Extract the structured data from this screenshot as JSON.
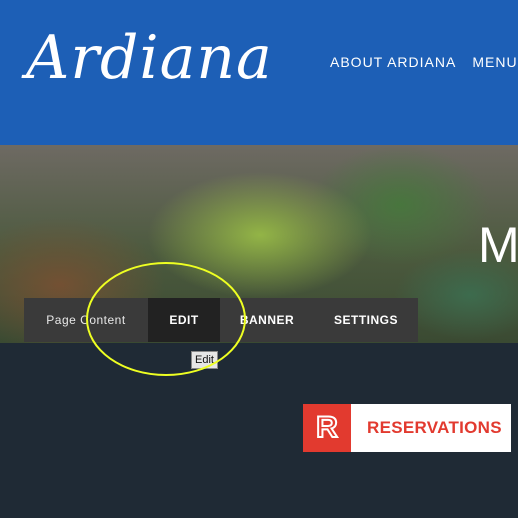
{
  "header": {
    "logo_text": "Ardiana",
    "nav": [
      "ABOUT ARDIANA",
      "MENU"
    ]
  },
  "hero": {
    "partial_heading": "M"
  },
  "editor_toolbar": {
    "section_label": "Page Content",
    "edit": "EDIT",
    "banner": "BANNER",
    "settings": "SETTINGS",
    "tooltip": "Edit"
  },
  "reservations": {
    "icon_letter": "R",
    "label": "RESERVATIONS"
  },
  "colors": {
    "header_bg": "#1d5fb6",
    "body_bg": "#1f2a35",
    "reservation_red": "#e23a2f",
    "highlight": "#eeff22"
  }
}
